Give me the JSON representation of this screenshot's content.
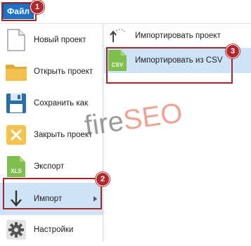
{
  "topbar": {
    "file_tab": "Файл"
  },
  "badges": {
    "b1": "1",
    "b2": "2",
    "b3": "3"
  },
  "left_menu": {
    "new_project": "Новый проект",
    "open_project": "Открыть проект",
    "save_as": "Сохранить как",
    "close_project": "Закрыть проект",
    "export": "Экспорт",
    "import": "Импорт",
    "settings": "Настройки"
  },
  "submenu": {
    "import_project": "Импортировать проект",
    "import_csv": "Импортировать из CSV"
  },
  "icons": {
    "xls_text": "XLS",
    "csv_text": "CSV"
  },
  "watermark": {
    "part1": "fire",
    "part2": "SEO"
  },
  "colors": {
    "accent": "#1a73c5",
    "highlight": "#a3262b",
    "selection": "#cfe3f6"
  }
}
